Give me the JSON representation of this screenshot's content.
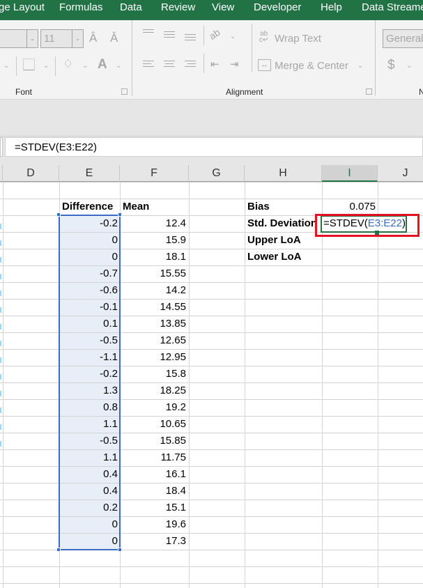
{
  "ribbon": {
    "tabs": [
      "ge Layout",
      "Formulas",
      "Data",
      "Review",
      "View",
      "Developer",
      "Help",
      "Data Streamer"
    ],
    "font_group": {
      "label": "Font",
      "font_size_value": "11",
      "icons": [
        "increase-font-size-icon",
        "decrease-font-size-icon",
        "borders-icon",
        "fill-color-icon",
        "font-color-icon"
      ]
    },
    "alignment_group": {
      "label": "Alignment",
      "wrap_text_label": "Wrap Text",
      "merge_center_label": "Merge & Center"
    },
    "number_group": {
      "label": "N",
      "format_value": "General",
      "currency_symbol": "$"
    },
    "accent_color": "#217346"
  },
  "formula_bar": {
    "value": "=STDEV(E3:E22)"
  },
  "columns": [
    "D",
    "E",
    "F",
    "G",
    "H",
    "I",
    "J"
  ],
  "active_column": "I",
  "table": {
    "headers": {
      "difference": "Difference",
      "mean": "Mean"
    },
    "rows": [
      {
        "difference": "-0.2",
        "mean": "12.4"
      },
      {
        "difference": "0",
        "mean": "15.9"
      },
      {
        "difference": "0",
        "mean": "18.1"
      },
      {
        "difference": "-0.7",
        "mean": "15.55"
      },
      {
        "difference": "-0.6",
        "mean": "14.2"
      },
      {
        "difference": "-0.1",
        "mean": "14.55"
      },
      {
        "difference": "0.1",
        "mean": "13.85"
      },
      {
        "difference": "-0.5",
        "mean": "12.65"
      },
      {
        "difference": "-1.1",
        "mean": "12.95"
      },
      {
        "difference": "-0.2",
        "mean": "15.8"
      },
      {
        "difference": "1.3",
        "mean": "18.25"
      },
      {
        "difference": "0.8",
        "mean": "19.2"
      },
      {
        "difference": "1.1",
        "mean": "10.65"
      },
      {
        "difference": "-0.5",
        "mean": "15.85"
      },
      {
        "difference": "1.1",
        "mean": "11.75"
      },
      {
        "difference": "0.4",
        "mean": "16.1"
      },
      {
        "difference": "0.4",
        "mean": "18.4"
      },
      {
        "difference": "0.2",
        "mean": "15.1"
      },
      {
        "difference": "0",
        "mean": "19.6"
      },
      {
        "difference": "0",
        "mean": "17.3"
      }
    ]
  },
  "stats": {
    "bias_label": "Bias",
    "bias_value": "0.075",
    "std_label": "Std. Deviation",
    "std_edit_prefix": "=STDEV(",
    "std_edit_ref": "E3:E22",
    "std_edit_suffix": ")",
    "upper_label": "Upper LoA",
    "lower_label": "Lower LoA"
  },
  "selection": {
    "range": "E3:E22",
    "highlight_color": "#3a6cc3",
    "annotation_color": "#e81123"
  }
}
